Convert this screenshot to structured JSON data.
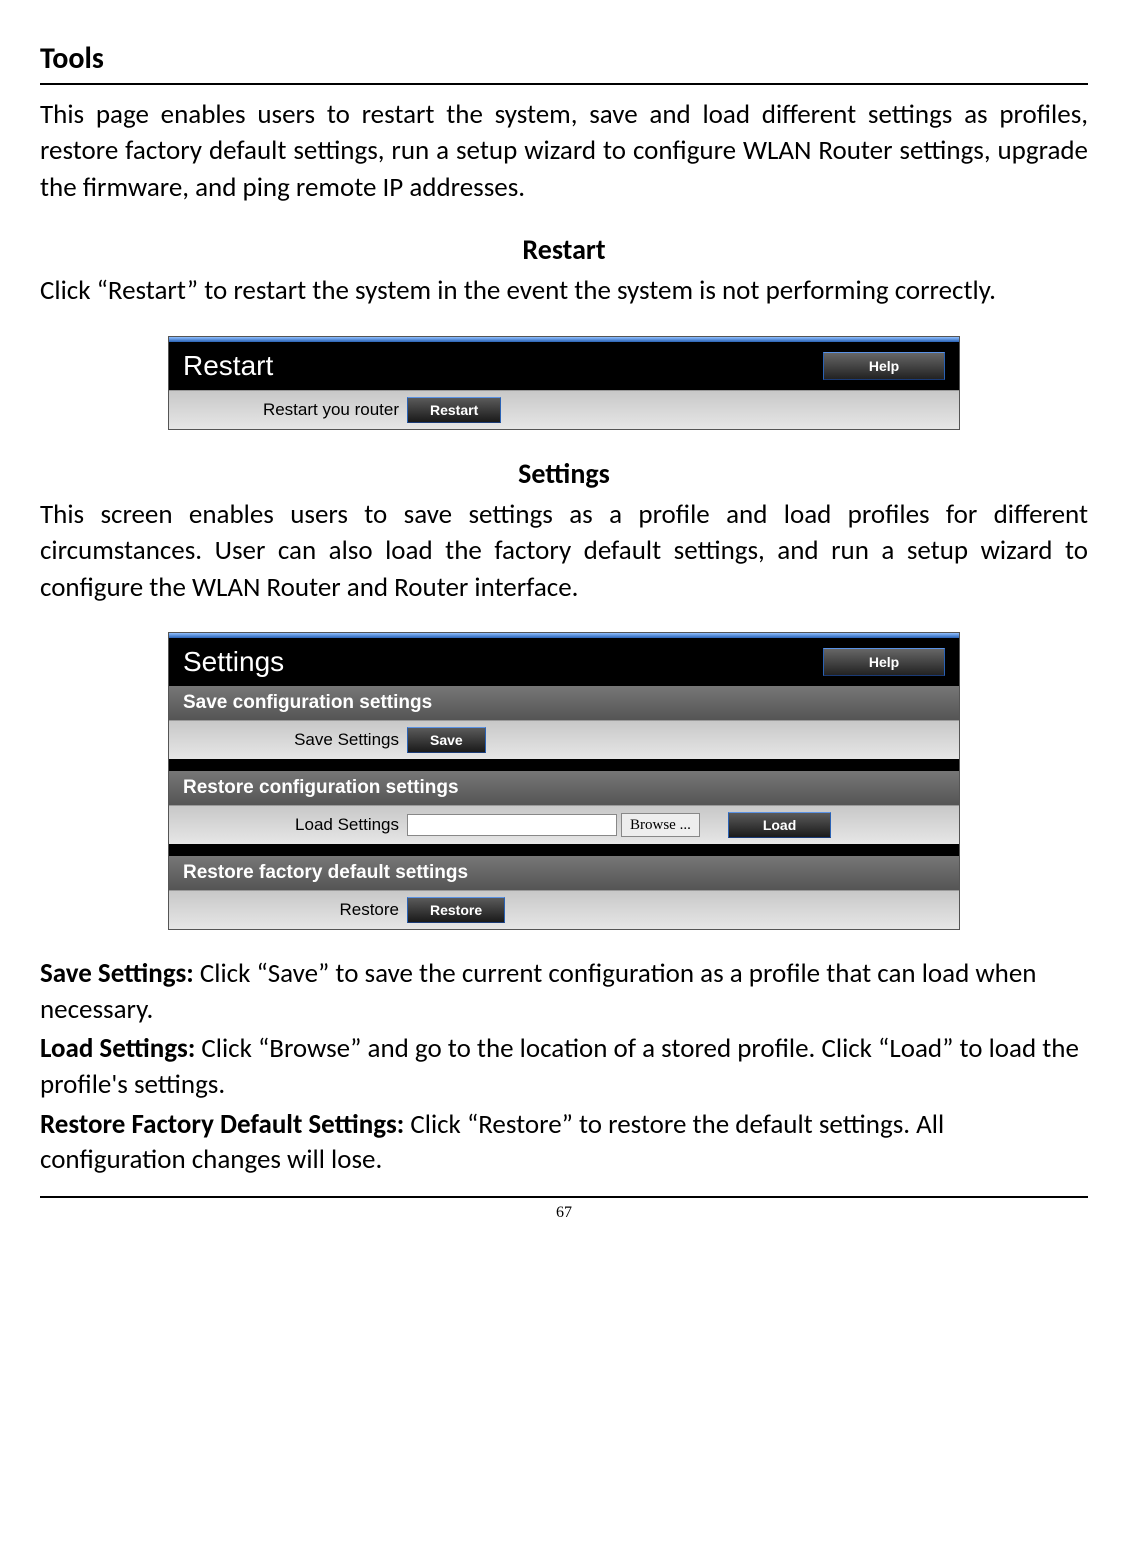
{
  "title": "Tools",
  "intro": "This page enables users to restart the system, save and load different settings as profiles, restore factory default settings, run a setup wizard to configure WLAN Router settings, upgrade the firmware, and ping remote IP addresses.",
  "restart": {
    "heading": "Restart",
    "body": "Click “Restart” to restart the system in the event the system is not performing correctly.",
    "panel_title": "Restart",
    "help": "Help",
    "row_label": "Restart you router",
    "button": "Restart"
  },
  "settings": {
    "heading": "Settings",
    "body": "This screen enables users to save settings as a profile and load profiles for different circumstances. User can also load the factory default settings, and run a setup wizard to configure the WLAN Router and Router interface.",
    "panel_title": "Settings",
    "help": "Help",
    "save": {
      "section": "Save configuration settings",
      "label": "Save Settings",
      "button": "Save"
    },
    "restore_cfg": {
      "section": "Restore configuration settings",
      "label": "Load Settings",
      "input": "",
      "browse": "Browse ...",
      "load": "Load"
    },
    "restore_factory": {
      "section": "Restore factory default settings",
      "label": "Restore",
      "button": "Restore"
    }
  },
  "notes": {
    "save_l": "Save Settings:",
    "save_t": " Click “Save” to save the current configuration as a profile that can load when necessary.",
    "load_l": "Load Settings:",
    "load_t": " Click “Browse” and go to the location of a stored profile. Click “Load” to load the profile's settings.",
    "rest_l": "Restore Factory Default Settings:",
    "rest_t": " Click “Restore” to restore the default settings. All configuration changes will lose."
  },
  "page_number": "67"
}
